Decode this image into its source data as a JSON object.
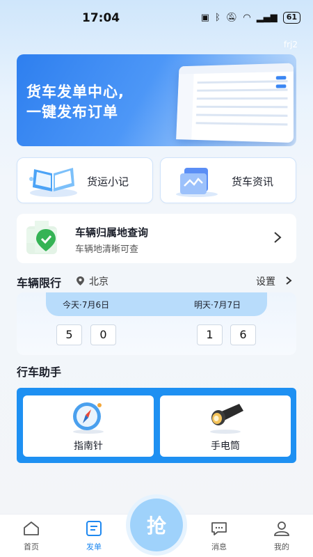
{
  "status_bar": {
    "time": "17:04",
    "battery": "61"
  },
  "header": {
    "user_tag": "frj2"
  },
  "banner": {
    "line1": "货车发单中心,",
    "line2": "一键发布订单"
  },
  "cards": [
    {
      "label": "货运小记",
      "icon": "book-icon"
    },
    {
      "label": "货车资讯",
      "icon": "news-icon"
    }
  ],
  "lookup": {
    "title": "车辆归属地查询",
    "subtitle": "车辆地清晰可查",
    "icon": "location-pin-icon"
  },
  "limit": {
    "title": "车辆限行",
    "city": "北京",
    "setting": "设置",
    "today_label": "今天·7月6日",
    "tomorrow_label": "明天·7月7日",
    "today_numbers": [
      "5",
      "0"
    ],
    "tomorrow_numbers": [
      "1",
      "6"
    ]
  },
  "assistant": {
    "title": "行车助手",
    "tools": [
      {
        "label": "指南针",
        "icon": "compass-icon"
      },
      {
        "label": "手电筒",
        "icon": "flashlight-icon"
      }
    ]
  },
  "nav": {
    "items": [
      {
        "label": "首页",
        "icon": "home-icon"
      },
      {
        "label": "发单",
        "icon": "order-icon",
        "active": true
      },
      {
        "label": "消息",
        "icon": "message-icon"
      },
      {
        "label": "我的",
        "icon": "profile-icon"
      }
    ],
    "center_button": "抢"
  },
  "colors": {
    "accent": "#1e88f0",
    "panel": "#1e90f2",
    "tab_bar": "#b8dcfb"
  }
}
